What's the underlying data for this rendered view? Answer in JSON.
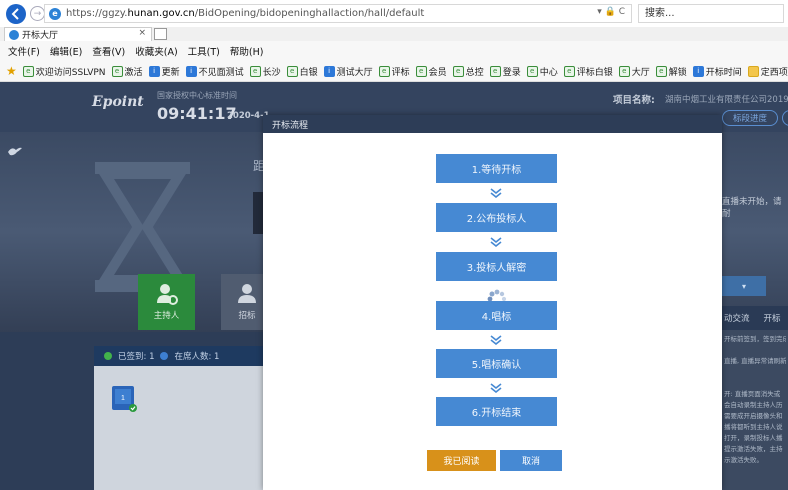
{
  "browser": {
    "url_prefix": "https://ggzy.",
    "url_host": "hunan.gov.cn",
    "url_path": "/BidOpening/bidopeninghallaction/hall/default",
    "url_tools": "▾ 🔒 C",
    "search_placeholder": "搜索...",
    "tab_title": "开标大厅",
    "tab_close": "×",
    "menu": [
      "文件(F)",
      "编辑(E)",
      "查看(V)",
      "收藏夹(A)",
      "工具(T)",
      "帮助(H)"
    ],
    "favorites": [
      {
        "label": "欢迎访问SSLVPN",
        "icon": "page-icon"
      },
      {
        "label": "激活",
        "icon": "page-icon"
      },
      {
        "label": "更新",
        "icon": "blue-icon"
      },
      {
        "label": "不见面测试",
        "icon": "blue-icon"
      },
      {
        "label": "长沙",
        "icon": "page-icon"
      },
      {
        "label": "白银",
        "icon": "page-icon"
      },
      {
        "label": "测试大厅",
        "icon": "blue-icon"
      },
      {
        "label": "评标",
        "icon": "page-icon"
      },
      {
        "label": "会员",
        "icon": "page-icon"
      },
      {
        "label": "总控",
        "icon": "page-icon"
      },
      {
        "label": "登录",
        "icon": "page-icon"
      },
      {
        "label": "中心",
        "icon": "page-icon"
      },
      {
        "label": "评标白银",
        "icon": "page-icon"
      },
      {
        "label": "大厅",
        "icon": "page-icon"
      },
      {
        "label": "解锁",
        "icon": "page-icon"
      },
      {
        "label": "开标时间",
        "icon": "blue-icon"
      },
      {
        "label": "定西项",
        "icon": "folder-icon"
      }
    ]
  },
  "page": {
    "logo": "Epoint",
    "time_label": "国家授权中心标准时间",
    "time": "09:41:17",
    "date": "2020-4-1",
    "project_label": "项目名称:",
    "project_value": "湖南中烟工业有限责任公司2019",
    "progress_button": "标段进度",
    "stage_text": "距",
    "stage_notice": "直播未开始，请耐",
    "role_host": "主持人",
    "role_second": "招标",
    "signed_label": "已签到: 1",
    "present_label": "在席人数: 1",
    "seat_number": "1",
    "right_tabs": [
      "动交流",
      "开标"
    ],
    "right_panel_lines": [
      "开标前签到，签到完成",
      "",
      "直播, 直播异常请刷新",
      "",
      "",
      "开: 直播页面消失或",
      "会自动录制主持人历",
      "需要成开启摄像头和",
      "播将都听到主持人说",
      "打开，录制投标人播",
      "提示激活失败，主持",
      "示激活失败。"
    ]
  },
  "modal": {
    "title": "开标流程",
    "steps": [
      "1.等待开标",
      "2.公布投标人",
      "3.投标人解密",
      "4.唱标",
      "5.唱标确认",
      "6.开标结束"
    ],
    "read_button": "我已阅读",
    "cancel_button": "取消"
  },
  "colors": {
    "step_blue": "#4689d3",
    "read_orange": "#d8911a",
    "header_navy": "#2d3d57",
    "host_green": "#2b8a3c"
  }
}
